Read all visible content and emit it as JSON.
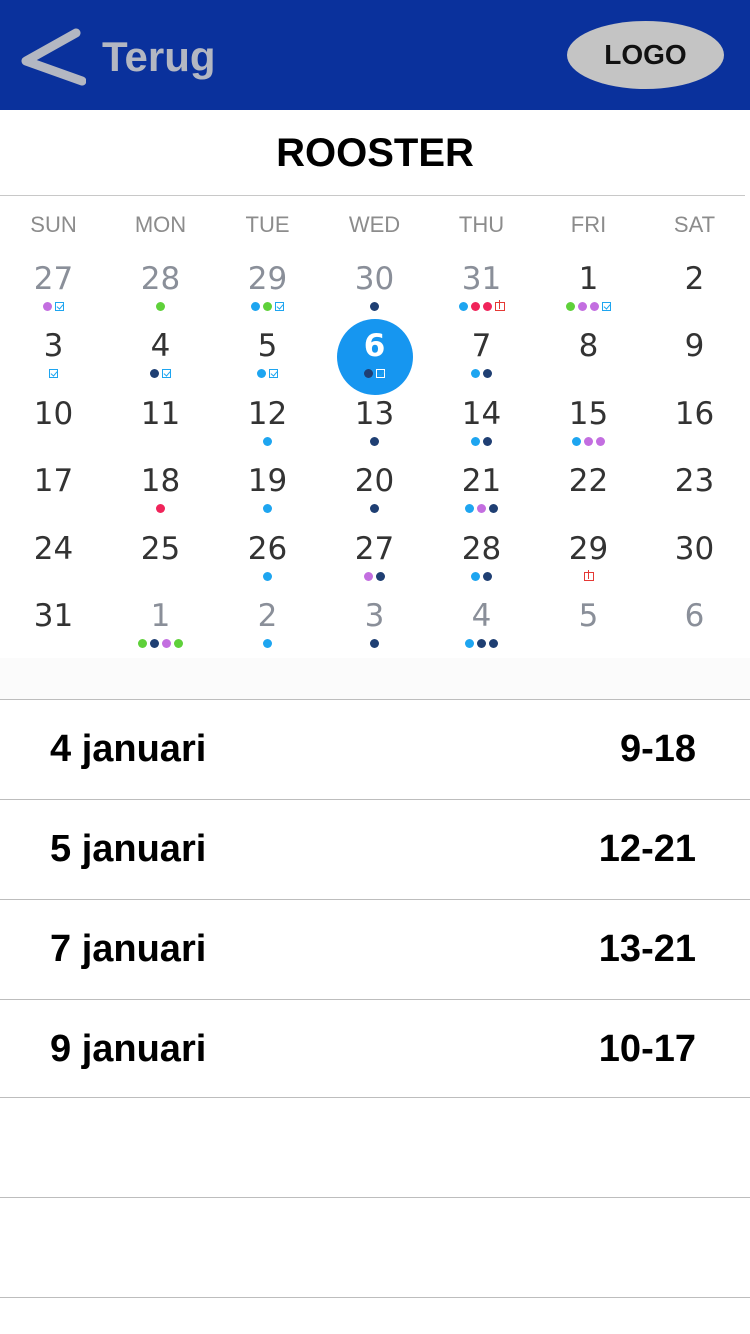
{
  "header": {
    "back_label": "Terug",
    "logo_label": "LOGO",
    "bg_color": "#0a319c"
  },
  "page": {
    "title": "ROOSTER"
  },
  "calendar": {
    "weekdays": [
      "SUN",
      "MON",
      "TUE",
      "WED",
      "THU",
      "FRI",
      "SAT"
    ],
    "selected_day": "6",
    "selected_color": "#1696f0",
    "weeks": [
      [
        {
          "label": "27",
          "other": true,
          "marks": [
            "purple",
            "check"
          ]
        },
        {
          "label": "28",
          "other": true,
          "marks": [
            "green"
          ]
        },
        {
          "label": "29",
          "other": true,
          "marks": [
            "blue",
            "green",
            "check"
          ]
        },
        {
          "label": "30",
          "other": true,
          "marks": [
            "navy"
          ]
        },
        {
          "label": "31",
          "other": true,
          "marks": [
            "blue",
            "red",
            "red",
            "gift"
          ]
        },
        {
          "label": "1",
          "other": false,
          "marks": [
            "green",
            "purple",
            "purple",
            "check"
          ]
        },
        {
          "label": "2",
          "other": false,
          "marks": []
        }
      ],
      [
        {
          "label": "3",
          "other": false,
          "marks": [
            "check"
          ]
        },
        {
          "label": "4",
          "other": false,
          "marks": [
            "navy",
            "check"
          ]
        },
        {
          "label": "5",
          "other": false,
          "marks": [
            "blue",
            "check"
          ]
        },
        {
          "label": "6",
          "other": false,
          "selected": true,
          "marks": [
            "navy",
            "checkwhite"
          ]
        },
        {
          "label": "7",
          "other": false,
          "marks": [
            "blue",
            "navy"
          ]
        },
        {
          "label": "8",
          "other": false,
          "marks": []
        },
        {
          "label": "9",
          "other": false,
          "marks": []
        }
      ],
      [
        {
          "label": "10",
          "other": false,
          "marks": []
        },
        {
          "label": "11",
          "other": false,
          "marks": []
        },
        {
          "label": "12",
          "other": false,
          "marks": [
            "blue"
          ]
        },
        {
          "label": "13",
          "other": false,
          "marks": [
            "navy"
          ]
        },
        {
          "label": "14",
          "other": false,
          "marks": [
            "blue",
            "navy"
          ]
        },
        {
          "label": "15",
          "other": false,
          "marks": [
            "blue",
            "purple",
            "purple"
          ]
        },
        {
          "label": "16",
          "other": false,
          "marks": []
        }
      ],
      [
        {
          "label": "17",
          "other": false,
          "marks": []
        },
        {
          "label": "18",
          "other": false,
          "marks": [
            "red"
          ]
        },
        {
          "label": "19",
          "other": false,
          "marks": [
            "blue"
          ]
        },
        {
          "label": "20",
          "other": false,
          "marks": [
            "navy"
          ]
        },
        {
          "label": "21",
          "other": false,
          "marks": [
            "blue",
            "purple",
            "navy"
          ]
        },
        {
          "label": "22",
          "other": false,
          "marks": []
        },
        {
          "label": "23",
          "other": false,
          "marks": []
        }
      ],
      [
        {
          "label": "24",
          "other": false,
          "marks": []
        },
        {
          "label": "25",
          "other": false,
          "marks": []
        },
        {
          "label": "26",
          "other": false,
          "marks": [
            "blue"
          ]
        },
        {
          "label": "27",
          "other": false,
          "marks": [
            "purple",
            "navy"
          ]
        },
        {
          "label": "28",
          "other": false,
          "marks": [
            "blue",
            "navy"
          ]
        },
        {
          "label": "29",
          "other": false,
          "marks": [
            "gift"
          ]
        },
        {
          "label": "30",
          "other": false,
          "marks": []
        }
      ],
      [
        {
          "label": "31",
          "other": false,
          "marks": []
        },
        {
          "label": "1",
          "other": true,
          "marks": [
            "green",
            "navy",
            "purple",
            "green"
          ]
        },
        {
          "label": "2",
          "other": true,
          "marks": [
            "blue"
          ]
        },
        {
          "label": "3",
          "other": true,
          "marks": [
            "navy"
          ]
        },
        {
          "label": "4",
          "other": true,
          "marks": [
            "blue",
            "navy",
            "navy"
          ]
        },
        {
          "label": "5",
          "other": true,
          "marks": []
        },
        {
          "label": "6",
          "other": true,
          "marks": []
        }
      ]
    ],
    "mark_colors": {
      "blue": "#1ea5f0",
      "green": "#5fd13a",
      "purple": "#c36ee0",
      "navy": "#1f3f73",
      "red": "#f0245a"
    }
  },
  "schedule": [
    {
      "date": "4 januari",
      "time": "9-18"
    },
    {
      "date": "5 januari",
      "time": "12-21"
    },
    {
      "date": "7 januari",
      "time": "13-21"
    },
    {
      "date": "9 januari",
      "time": "10-17"
    },
    {
      "date": "",
      "time": ""
    },
    {
      "date": "",
      "time": ""
    }
  ]
}
